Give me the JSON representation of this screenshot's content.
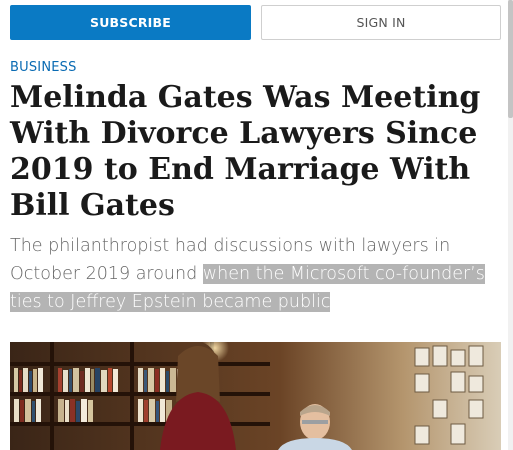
{
  "header": {
    "subscribe_label": "SUBSCRIBE",
    "signin_label": "SIGN IN",
    "accent_color": "#0a7ac4"
  },
  "article": {
    "section": "BUSINESS",
    "headline": "Melinda Gates Was Meeting With Divorce Lawyers Since 2019 to End Marriage With Bill Gates",
    "dek_plain": "The philanthropist had discussions with lawyers in October 2019 around ",
    "dek_highlighted": "when the Microsoft co-founder’s ties to Jeffrey Epstein became public"
  },
  "image": {
    "icon": "article-photo"
  }
}
